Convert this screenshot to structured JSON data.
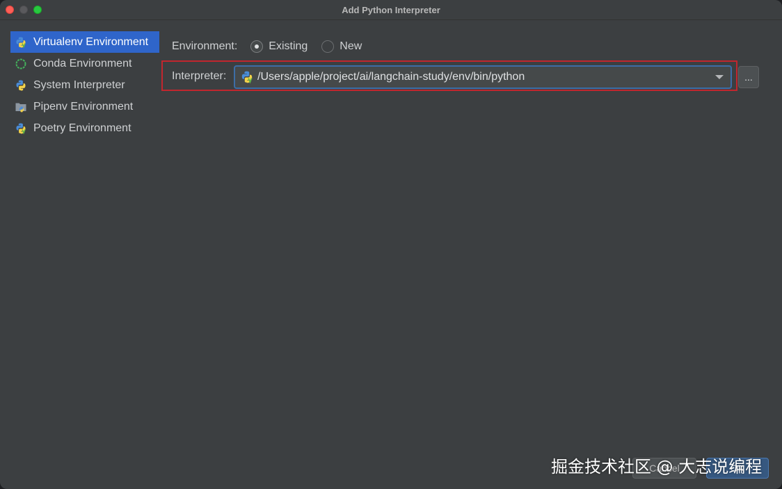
{
  "window": {
    "title": "Add Python Interpreter"
  },
  "sidebar": {
    "items": [
      {
        "label": "Virtualenv Environment",
        "icon": "python-virtualenv-icon",
        "selected": true
      },
      {
        "label": "Conda Environment",
        "icon": "conda-icon",
        "selected": false
      },
      {
        "label": "System Interpreter",
        "icon": "python-icon",
        "selected": false
      },
      {
        "label": "Pipenv Environment",
        "icon": "pipenv-folder-icon",
        "selected": false
      },
      {
        "label": "Poetry Environment",
        "icon": "python-poetry-icon",
        "selected": false
      }
    ]
  },
  "environment": {
    "label": "Environment:",
    "options": [
      {
        "label": "Existing",
        "checked": true
      },
      {
        "label": "New",
        "checked": false
      }
    ]
  },
  "interpreter": {
    "label": "Interpreter:",
    "value": "/Users/apple/project/ai/langchain-study/env/bin/python",
    "browse_label": "..."
  },
  "buttons": {
    "cancel": "Cancel",
    "ok": "OK"
  },
  "watermark": "掘金技术社区 @ 大志说编程",
  "colors": {
    "selection": "#2f65ca",
    "highlight_border": "#c2262e",
    "focus_border": "#3d6da6",
    "background": "#3c3f41"
  }
}
